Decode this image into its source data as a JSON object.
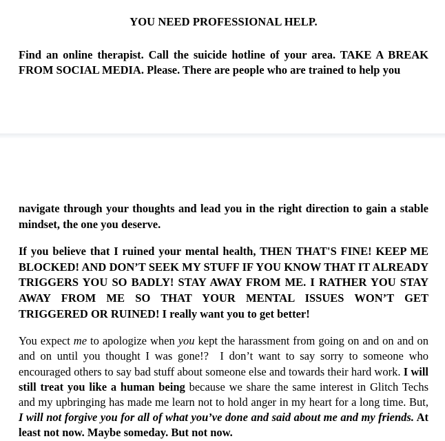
{
  "document": {
    "heading": "YOU NEED PROFESSIONAL HELP.",
    "top_section": {
      "paragraph_1": "Find an online therapist. Call the suicide hotline of your area. TAKE A BREAK FROM SOCIAL MEDIA. Please. There are people who are trained to help you"
    },
    "bottom_section": {
      "paragraph_continuation": "navigate through your thoughts and lead you in the right direction to gain a stable mindset, the one you deserve.",
      "paragraph_blocked": "If you believe that I ruined your mental health, THEN THAT'S FINE! KEEP ME BLOCKED! AND DON’T SEEK MY STUFF IF YOU KNOW THAT IT ALREADY TRIGGERS YOU SO BADLY! STAY AWAY FROM ME. I RATHER YOU STAY AWAY FROM ME SO THAT YOUR MENTAL ISSUES WON’T GET TRIGGERED OR RUINED! I really want you to get better!",
      "paragraph_apology": {
        "run_1": "You expect ",
        "run_2_italic": "me",
        "run_3": " to apologize when ",
        "run_4_italic": "you",
        "run_5": " kept the harassment from going on and on and on and on until you thought I was gone!? I don’t want to say sorry to someone who encouraged others to say bad stuff about someone else and towards their hard work. ",
        "run_6_bold": "I will still treat you like a human being",
        "run_7": " because we share the same interest in Glitch Techs and my upbringing has made me learn not to hold anger in my heart for a long time. But, ",
        "run_8_bold_italic": "I will not forgive you for all of what you’ve done and said about me and my friends.",
        "run_9_bold": " At least not now. Maybe someday. But not now."
      }
    }
  },
  "colors": {
    "text": "#000000",
    "background": "#ffffff",
    "divider": "#eceef1"
  }
}
